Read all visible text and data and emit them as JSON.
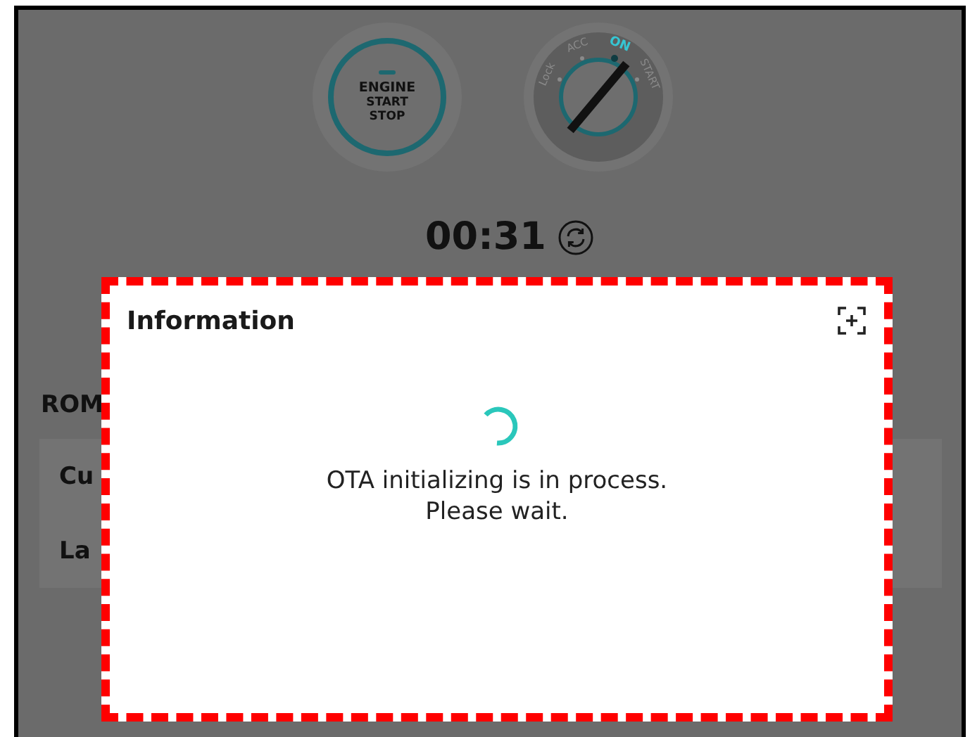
{
  "engine_button": {
    "lines": [
      "ENGINE",
      "START",
      "STOP"
    ]
  },
  "ignition_dial": {
    "positions": [
      {
        "label": "Lock",
        "selected": false
      },
      {
        "label": "ACC",
        "selected": false
      },
      {
        "label": "ON",
        "selected": true
      },
      {
        "label": "START",
        "selected": false
      }
    ]
  },
  "timer": {
    "value": "00:31"
  },
  "rom_section": {
    "title": "ROM",
    "rows": [
      {
        "label": "Cu"
      },
      {
        "label": "La"
      }
    ]
  },
  "dialog": {
    "title": "Information",
    "message_lines": [
      "OTA initializing is in process.",
      "Please wait."
    ]
  }
}
